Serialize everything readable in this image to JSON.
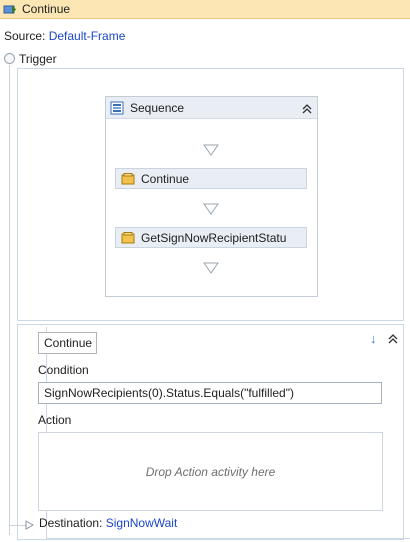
{
  "window": {
    "title": "Continue",
    "icon": "transition-icon"
  },
  "source": {
    "label": "Source:",
    "value": "Default-Frame"
  },
  "trigger": {
    "label": "Trigger",
    "sequence": {
      "title": "Sequence",
      "activities": [
        {
          "label": "Continue",
          "icon": "activity-icon"
        },
        {
          "label": "GetSignNowRecipientStatu",
          "icon": "activity-icon"
        }
      ]
    }
  },
  "transition": {
    "name": "Continue",
    "condition_label": "Condition",
    "condition_value": "SignNowRecipients(0).Status.Equals(\"fulfilled\")",
    "action_label": "Action",
    "action_placeholder": "Drop Action activity here",
    "destination_label": "Destination:",
    "destination_value": "SignNowWait"
  },
  "colors": {
    "titlebar_bg": "#fce7b4",
    "link": "#1a46c9",
    "panel_border": "#cdd8e6",
    "activity_bg": "#e9eef5"
  }
}
